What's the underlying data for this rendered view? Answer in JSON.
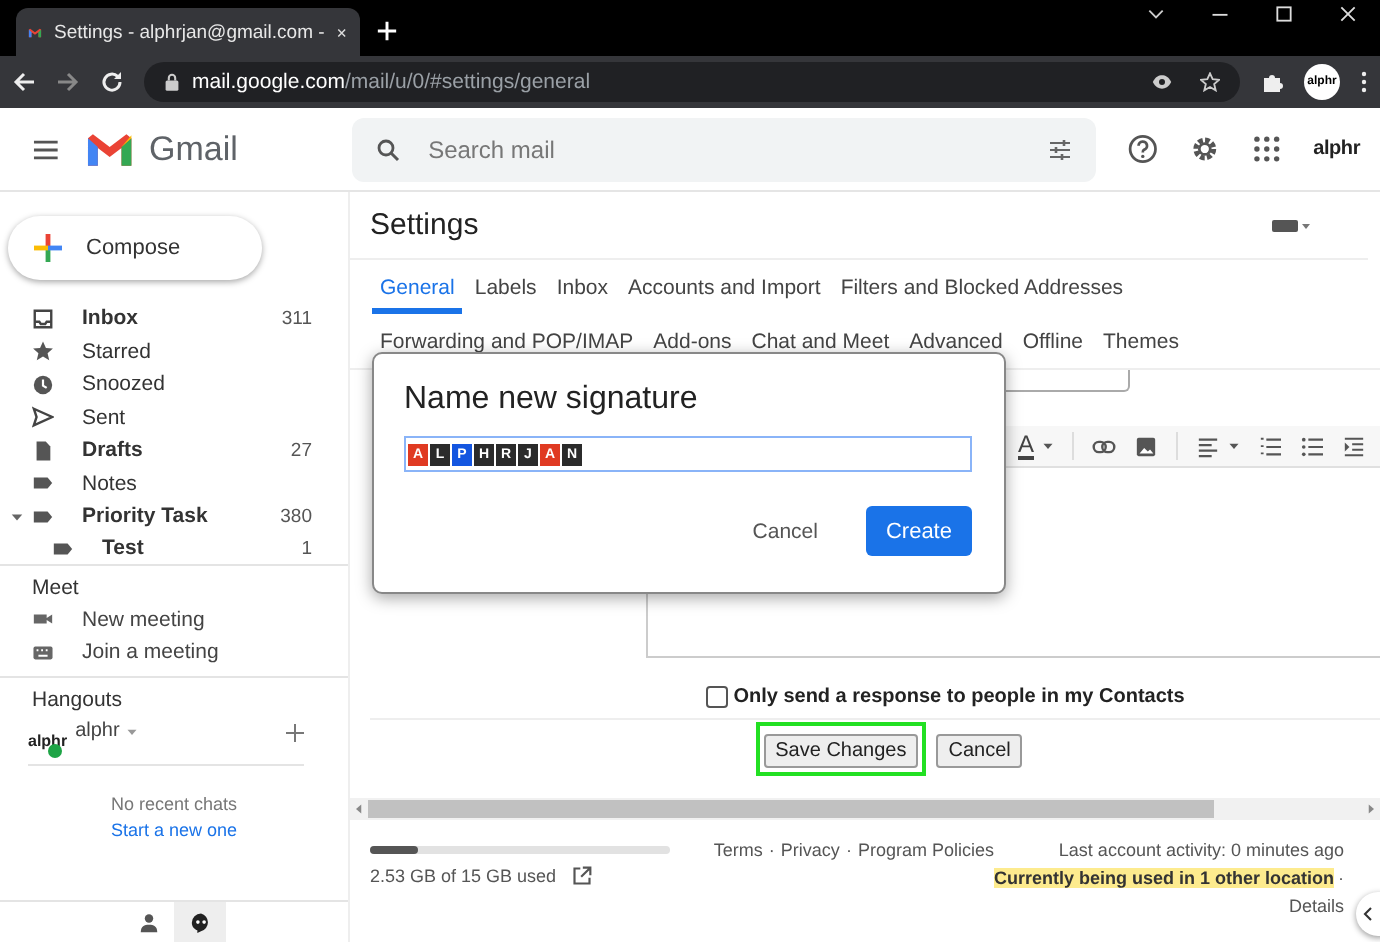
{
  "browser": {
    "tab": {
      "title": "Settings - alphrjan@gmail.com -"
    },
    "address": {
      "host": "mail.google.com",
      "path": "/mail/u/0/#settings/general"
    },
    "profile": "alphr"
  },
  "header": {
    "app_name": "Gmail",
    "search": {
      "placeholder": "Search mail"
    },
    "account": "alphr"
  },
  "sidebar": {
    "compose": "Compose",
    "items": [
      {
        "label": "Inbox",
        "count": "311",
        "kind": "inbox",
        "unread": true
      },
      {
        "label": "Starred",
        "kind": "star",
        "unread": false
      },
      {
        "label": "Snoozed",
        "kind": "clock",
        "unread": false
      },
      {
        "label": "Sent",
        "kind": "send",
        "unread": false
      },
      {
        "label": "Drafts",
        "count": "27",
        "kind": "file",
        "unread": true
      },
      {
        "label": "Notes",
        "kind": "label",
        "unread": false
      },
      {
        "label": "Priority Task",
        "count": "380",
        "kind": "label",
        "unread": true,
        "expanded": true,
        "children": [
          {
            "label": "Test",
            "count": "1",
            "kind": "label",
            "unread": true
          }
        ]
      }
    ],
    "meet": {
      "title": "Meet",
      "items": [
        {
          "label": "New meeting",
          "kind": "video"
        },
        {
          "label": "Join a meeting",
          "kind": "keyboard"
        }
      ]
    },
    "hangouts": {
      "title": "Hangouts",
      "logo": "alphr",
      "user": "alphr",
      "online": true,
      "empty_text": "No recent chats",
      "start_link": "Start a new one"
    },
    "bottom_tabs": [
      {
        "kind": "person",
        "selected": false
      },
      {
        "kind": "chat",
        "selected": true
      }
    ]
  },
  "settings": {
    "title": "Settings",
    "tab_rows": [
      [
        {
          "label": "General",
          "selected": true
        },
        {
          "label": "Labels",
          "selected": false
        },
        {
          "label": "Inbox",
          "selected": false
        },
        {
          "label": "Accounts and Import",
          "selected": false
        },
        {
          "label": "Filters and Blocked Addresses",
          "selected": false
        }
      ],
      [
        {
          "label": "Forwarding and POP/IMAP",
          "selected": false
        },
        {
          "label": "Add-ons",
          "selected": false
        },
        {
          "label": "Chat and Meet",
          "selected": false
        },
        {
          "label": "Advanced",
          "selected": false
        },
        {
          "label": "Offline",
          "selected": false
        },
        {
          "label": "Themes",
          "selected": false
        }
      ]
    ]
  },
  "signature_editor": {
    "font_color_glyph": "A"
  },
  "contacts_only": {
    "label": "Only send a response to people in my Contacts",
    "checked": false
  },
  "buttons": [
    {
      "label": "Save Changes",
      "highlighted": true
    },
    {
      "label": "Cancel",
      "highlighted": false
    }
  ],
  "footer": {
    "storage": {
      "level": 0.16,
      "text": "2.53 GB of 15 GB used"
    },
    "links": [
      "Terms",
      "Privacy",
      "Program Policies"
    ],
    "separator": "·",
    "activity": "Last account activity: 0 minutes ago",
    "other_location": "Currently being used in 1 other location",
    "details": "Details"
  },
  "dialog": {
    "title": "Name new signature",
    "value_tiles": [
      {
        "char": "A",
        "color": "#e03a22"
      },
      {
        "char": "L",
        "color": "#2b2b2b"
      },
      {
        "char": "P",
        "color": "#1456e0"
      },
      {
        "char": "H",
        "color": "#2b2b2b"
      },
      {
        "char": "R",
        "color": "#2b2b2b"
      },
      {
        "char": "J",
        "color": "#2b2b2b"
      },
      {
        "char": "A",
        "color": "#e03a22"
      },
      {
        "char": "N",
        "color": "#2b2b2b"
      }
    ],
    "buttons": [
      {
        "label": "Cancel",
        "kind": "text"
      },
      {
        "label": "Create",
        "kind": "primary"
      }
    ]
  }
}
